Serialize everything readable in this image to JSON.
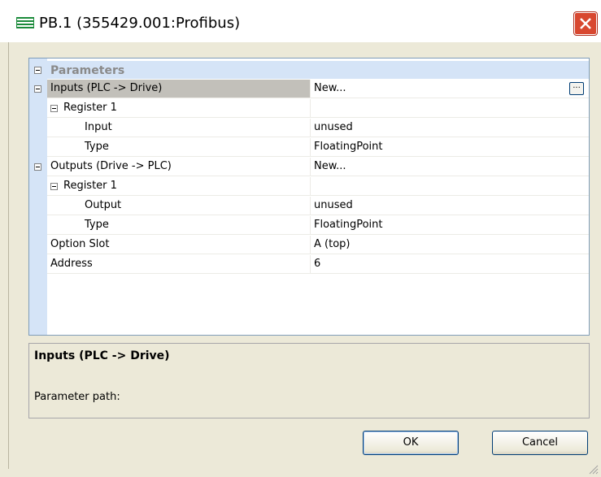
{
  "window": {
    "title": "PB.1 (355429.001:Profibus)",
    "icon": "sew-logo-icon",
    "close_icon": "close-icon"
  },
  "grid": {
    "category": "Parameters",
    "rows": [
      {
        "name": "Inputs (PLC -> Drive)",
        "value": "New...",
        "selected": true,
        "expandable": true
      },
      {
        "name": "Register 1",
        "value": "",
        "expandable": true
      },
      {
        "name": "Input",
        "value": "unused"
      },
      {
        "name": "Type",
        "value": "FloatingPoint"
      },
      {
        "name": "Outputs (Drive -> PLC)",
        "value": "New...",
        "expandable": true
      },
      {
        "name": "Register 1",
        "value": "",
        "expandable": true
      },
      {
        "name": "Output",
        "value": "unused"
      },
      {
        "name": "Type",
        "value": "FloatingPoint"
      },
      {
        "name": "Option Slot",
        "value": "A (top)"
      },
      {
        "name": "Address",
        "value": "6"
      }
    ]
  },
  "help": {
    "title": "Inputs (PLC -> Drive)",
    "description": "Parameter path:"
  },
  "buttons": {
    "ok": "OK",
    "cancel": "Cancel"
  },
  "colors": {
    "gutter": "#d5e4f7",
    "selected_row": "#c2c0ba",
    "close_button": "#d84830"
  }
}
